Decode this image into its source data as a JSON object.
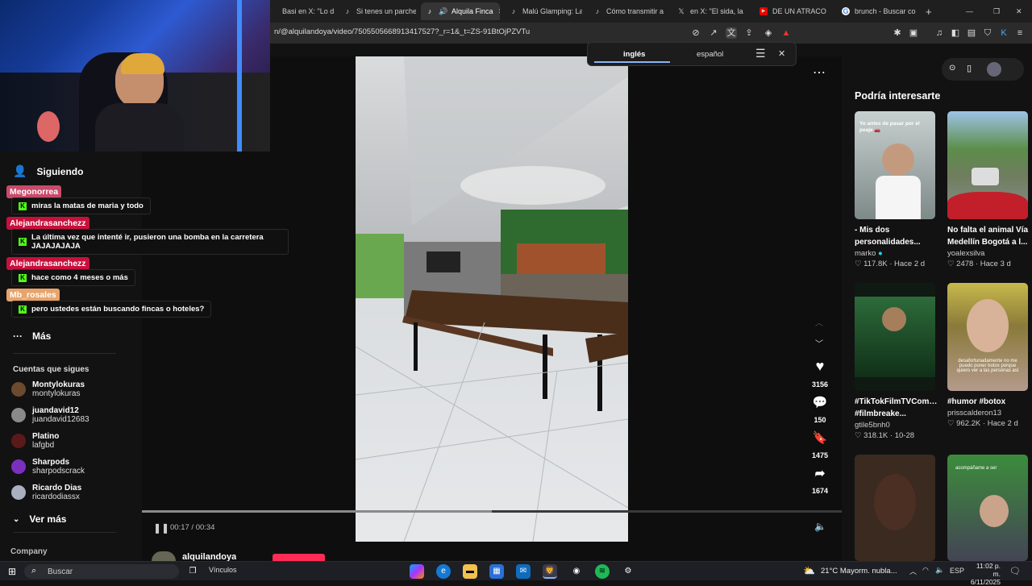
{
  "browser": {
    "tabs": [
      {
        "label": "Basi en X: \"Lo de la",
        "icon": "x-icon"
      },
      {
        "label": "Si tenes un parche",
        "icon": "tiktok-icon"
      },
      {
        "label": "Alquila Finca",
        "icon": "tiktok-icon",
        "active": true
      },
      {
        "label": "Malú Glamping: La",
        "icon": "tiktok-icon"
      },
      {
        "label": "Cómo transmitir a",
        "icon": "tiktok-icon"
      },
      {
        "label": "en X: \"El sida, la",
        "icon": "x-icon"
      },
      {
        "label": "DE UN ATRACO",
        "icon": "youtube-icon"
      },
      {
        "label": "brunch - Buscar con",
        "icon": "google-icon"
      }
    ],
    "new_tab": "+",
    "url": "n/@alquilandoya/video/7505505668913417527?_r=1&_t=ZS-91BtOjPZVTu"
  },
  "translate_popup": {
    "lang_from": "inglés",
    "lang_to": "español"
  },
  "sidebar": {
    "following_label": "Siguiendo",
    "more_label": "Más",
    "accounts_title": "Cuentas que sigues",
    "accounts": [
      {
        "name": "Montylokuras",
        "handle": "montylokuras",
        "color": "#6b4a2e"
      },
      {
        "name": "juandavid12",
        "handle": "juandavid12683",
        "color": "#8a8a8a"
      },
      {
        "name": "Platino",
        "handle": "lafgbd",
        "color": "#5a1a1a"
      },
      {
        "name": "Sharpods",
        "handle": "sharpodscrack",
        "color": "#7b2fbf"
      },
      {
        "name": "Ricardo Dias",
        "handle": "ricardodiassx",
        "color": "#aab0c0"
      }
    ],
    "see_more": "Ver más",
    "company": "Company"
  },
  "chat": [
    {
      "user": "Megonorrea",
      "color": "#c94a6a",
      "message": "miras la matas de maria y todo"
    },
    {
      "user": "Alejandrasanchezz",
      "color": "#c8103c",
      "message": "La última vez que intenté ir, pusieron una bomba en la carretera JAJAJAJAJA"
    },
    {
      "user": "Alejandrasanchezz",
      "color": "#c8103c",
      "message": "hace como 4 meses o más"
    },
    {
      "user": "Mb_rosales",
      "color": "#e8a46a",
      "message": "pero ustedes están buscando fincas o hoteles?"
    }
  ],
  "video": {
    "time": "00:17 / 00:34",
    "progress": 0.5,
    "author": "alquilandoya",
    "likes": "3156",
    "comments": "150",
    "saves": "1475",
    "shares": "1674"
  },
  "recommended": {
    "title": "Podría interesarte",
    "cards": [
      {
        "title": "- Mis dos personalidades...",
        "user": "marko",
        "likes": "117.8K",
        "date": "Hace 2 d",
        "caption": "Yo antes de pasar por el peaje 🚗"
      },
      {
        "title": "No falta el animal Vía Medellín Bogotá a l...",
        "user": "yoalexsilva",
        "likes": "2478",
        "date": "Hace 3 d",
        "caption": ""
      },
      {
        "title": "#TikTokFilmTVCompetition #filmbreake...",
        "user": "gtile5bnh0",
        "likes": "318.1K",
        "date": "10-28",
        "caption": ""
      },
      {
        "title": "#humor #botox",
        "user": "prisscalderon13",
        "likes": "962.2K",
        "date": "Hace 2 d",
        "caption": "desafortunadamente no me puedo poner botox porque quiero ver a las personas así"
      },
      {
        "title": "",
        "user": "",
        "likes": "",
        "date": "",
        "caption": ""
      },
      {
        "title": "",
        "user": "",
        "likes": "",
        "date": "",
        "caption": "acompáñame a ser"
      }
    ]
  },
  "taskbar": {
    "search_placeholder": "Buscar",
    "links_label": "Vínculos",
    "weather": "21°C  Mayorm. nubla...",
    "lang": "ESP",
    "time": "11:02 p. m.",
    "date": "6/11/2025"
  }
}
